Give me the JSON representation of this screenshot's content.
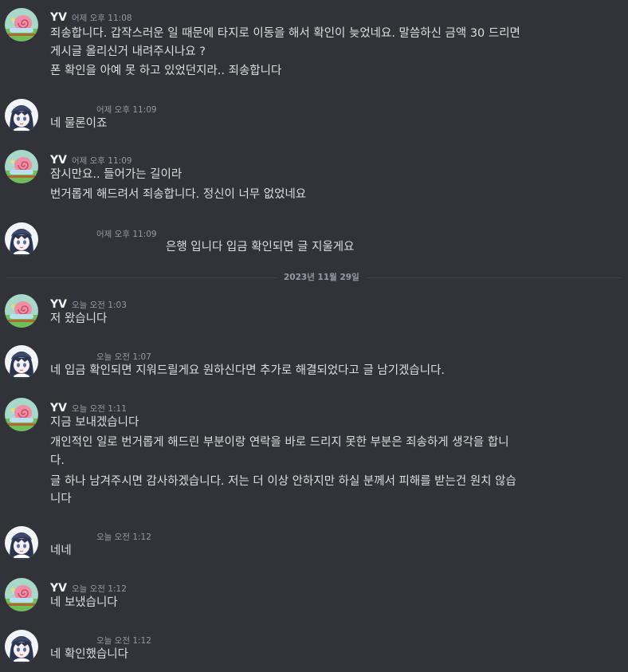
{
  "users": {
    "yv": {
      "name": "YV",
      "avatar_icon": "snail-icon"
    },
    "other": {
      "name": "",
      "avatar_icon": "anime-girl-icon"
    }
  },
  "messages": [
    {
      "user": "YV",
      "time": "어제 오후 11:08",
      "lines": [
        "죄송합니다. 갑작스러운 일 때문에 타지로 이동을 해서 확인이 늦었네요. 말씀하신 금액 30 드리면",
        "게시글 올리신거 내려주시나요 ?",
        "폰 확인을 아예 못 하고 있었던지라.. 죄송합니다"
      ]
    },
    {
      "user": "",
      "time": "어제 오후 11:09",
      "lines": [
        "네 물론이죠"
      ]
    },
    {
      "user": "YV",
      "time": "어제 오후 11:09",
      "lines": [
        "잠시만요.. 들어가는 길이라",
        "번거롭게 해드려서 죄송합니다. 정신이 너무 없었네요"
      ]
    },
    {
      "user": "",
      "time": "어제 오후 11:09",
      "lines": [
        "은행 입니다 입금 확인되면 글 지울게요"
      ]
    },
    {
      "user": "YV",
      "time": "오늘 오전 1:03",
      "lines": [
        "저 왔습니다"
      ]
    },
    {
      "user": "",
      "time": "오늘 오전 1:07",
      "lines": [
        "네 입금 확인되면 지워드릴게요 원하신다면 추가로 해결되었다고 글 남기겠습니다."
      ]
    },
    {
      "user": "YV",
      "time": "오늘 오전 1:11",
      "lines": [
        "지금 보내겠습니다",
        "개인적인 일로 번거롭게 해드린 부분이랑 연락을 바로 드리지 못한 부분은 죄송하게 생각을 합니",
        "다.",
        "글 하나 남겨주시면 감사하겠습니다. 저는 더 이상 안하지만 하실 분께서 피해를 받는건 원치 않습",
        "니다"
      ]
    },
    {
      "user": "",
      "time": "오늘 오전 1:12",
      "lines": [
        "네네"
      ]
    },
    {
      "user": "YV",
      "time": "오늘 오전 1:12",
      "lines": [
        "네 보냈습니다"
      ]
    },
    {
      "user": "",
      "time": "오늘 오전 1:12",
      "lines": [
        "네 확인했습니다"
      ]
    }
  ],
  "date_divider": "2023년 11월 29일",
  "colors": {
    "background": "#313338",
    "text": "#dbdee1",
    "muted": "#949ba4",
    "author": "#f2f3f5"
  }
}
